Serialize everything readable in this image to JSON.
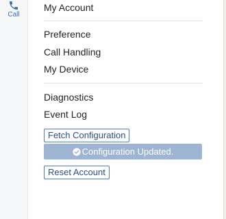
{
  "rail": {
    "call_label": "Call",
    "accent_color": "#3a6fb0"
  },
  "menu": {
    "account": "My Account",
    "preference": "Preference",
    "call_handling": "Call Handling",
    "my_device": "My Device",
    "diagnostics": "Diagnostics",
    "event_log": "Event Log"
  },
  "actions": {
    "fetch_configuration": "Fetch Configuration",
    "status_message": "Configuration Updated.",
    "reset_account": "Reset Account"
  },
  "colors": {
    "banner_bg": "#9db5d2",
    "button_border": "#4a7cc2"
  }
}
